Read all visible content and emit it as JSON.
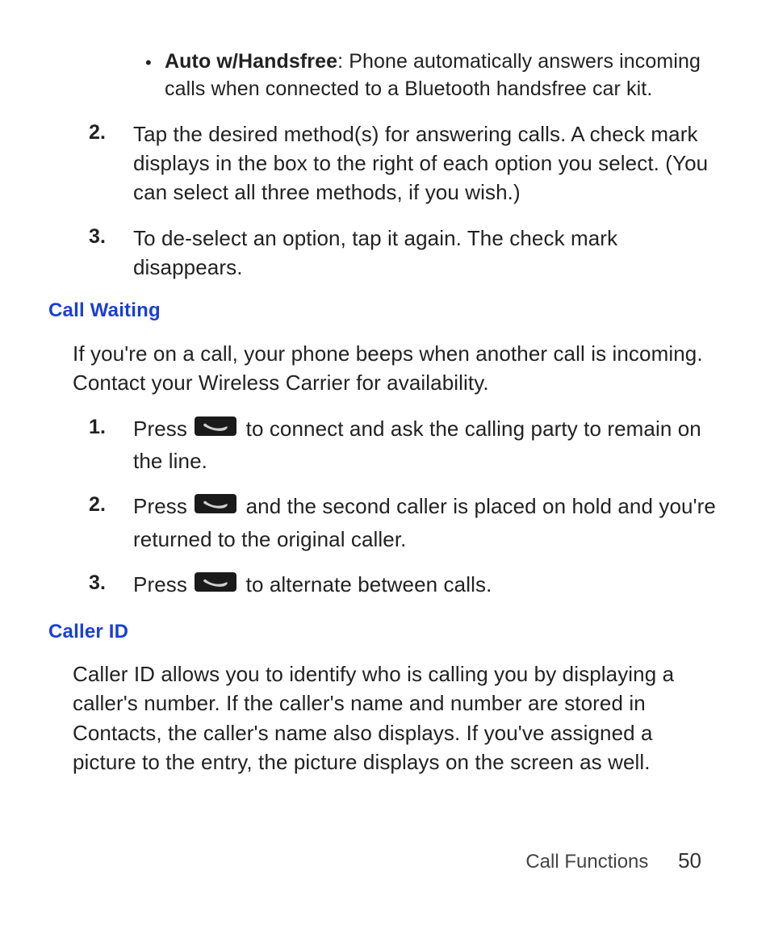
{
  "bullet": {
    "title": "Auto w/Handsfree",
    "rest": ": Phone automatically answers incoming calls when connected to a Bluetooth handsfree car kit."
  },
  "top_steps": {
    "s2": {
      "num": "2.",
      "text": "Tap the desired method(s) for answering calls. A check mark displays in the box to the right of each option you select. (You can select all three methods, if you wish.)"
    },
    "s3": {
      "num": "3.",
      "text": "To de-select an option, tap it again. The check mark disappears."
    }
  },
  "call_waiting": {
    "heading": "Call Waiting",
    "intro": "If you're on a call, your phone beeps when another call is incoming. Contact your Wireless Carrier for availability.",
    "s1": {
      "num": "1.",
      "pre": "Press ",
      "post": " to connect and ask the calling party to remain on the line."
    },
    "s2": {
      "num": "2.",
      "pre": "Press ",
      "post": " and the second caller is placed on hold and you're returned to the original caller."
    },
    "s3": {
      "num": "3.",
      "pre": "Press ",
      "post": " to alternate between calls."
    }
  },
  "caller_id": {
    "heading": "Caller ID",
    "body": "Caller ID allows you to identify who is calling you by displaying a caller's number. If the caller's name and number are stored in Contacts, the caller's name also displays. If you've assigned a picture to the entry, the picture displays on the screen as well."
  },
  "footer": {
    "section": "Call Functions",
    "page": "50"
  }
}
